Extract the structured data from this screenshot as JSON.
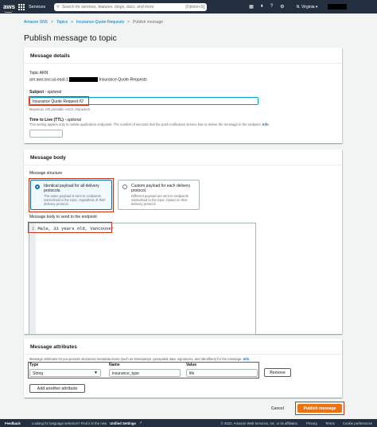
{
  "nav": {
    "logo": "aws",
    "services": "Services",
    "search_placeholder": "Search for services, features, blogs, docs, and more",
    "search_shortcut": "[Option+S]",
    "icons": [
      "terminal-icon",
      "bell-icon",
      "help-icon",
      "gear-icon"
    ],
    "region": "N. Virginia ▾"
  },
  "breadcrumb": [
    "Amazon SNS",
    "Topics",
    "Insurance-Quote-Requests",
    "Publish message"
  ],
  "page_title": "Publish message to topic",
  "details": {
    "header": "Message details",
    "arn_label": "Topic ARN",
    "arn_prefix": "arn:aws:sns:us-east-1:",
    "arn_suffix": ":Insurance-Quote-Requests",
    "subject_label": "Subject",
    "subject_optional": " - optional",
    "subject_value": "Insurance Quote Request #2",
    "subject_hint": "Maximum 100 printable ASCII characters",
    "ttl_label": "Time to Live (TTL)",
    "ttl_optional": " - optional",
    "ttl_hint": "This setting applies only to mobile application endpoints. The number of seconds that the push notification service has to deliver the message to the endpoint.",
    "info": "Info"
  },
  "body": {
    "header": "Message body",
    "structure_label": "Message structure",
    "option1_title": "Identical payload for all delivery protocols.",
    "option1_desc": "The same payload is sent to endpoints subscribed to the topic, regardless of their delivery protocol.",
    "option2_title": "Custom payload for each delivery protocol.",
    "option2_desc": "Different payload are sent to endpoints subscribed to the topic, based on their delivery protocol.",
    "editor_label": "Message body to send to the endpoint",
    "line_number": "1",
    "code": "Male, 33 years old, Vancouver"
  },
  "attributes": {
    "header": "Message attributes",
    "desc": "Message attributes let you provide structured metadata items (such as timestamps, geospatial data, signatures, and identifiers) for the message.",
    "info": "Info",
    "type_label": "Type",
    "name_label": "Name",
    "value_label": "Value",
    "type_value": "String",
    "name_value": "insurance_type",
    "value_value": "life",
    "remove": "Remove",
    "add": "Add another attribute"
  },
  "actions": {
    "cancel": "Cancel",
    "publish": "Publish message"
  },
  "footer": {
    "feedback": "Feedback",
    "lang_prompt": "Looking for language selection? Find it in the new",
    "unified": "Unified Settings",
    "copyright": "© 2022, Amazon Web Services, Inc. or its affiliates.",
    "privacy": "Privacy",
    "terms": "Terms",
    "cookie": "Cookie preferences"
  }
}
